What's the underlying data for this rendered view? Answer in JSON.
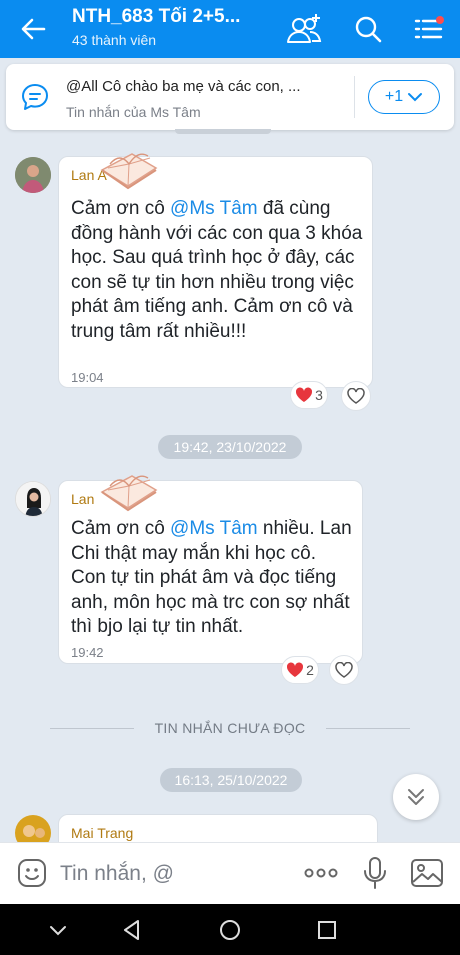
{
  "header": {
    "title": "NTH_683 Tối 2+5...",
    "subtitle": "43 thành viên",
    "icons": [
      "back-arrow-icon",
      "add-member-icon",
      "search-icon",
      "menu-list-icon"
    ],
    "accent": "#0a8cf0"
  },
  "pinned": {
    "text": "@All Cô chào ba mẹ và các con, ...",
    "sender": "Tin nhắn của Ms Tâm",
    "more_label": "+1"
  },
  "messages": [
    {
      "sender": "Lan A",
      "text_before": "Cảm ơn cô ",
      "mention": "@Ms Tâm",
      "text_after": " đã cùng đồng hành với các con qua 3 khóa học. Sau quá trình học ở đây, các con sẽ tự tin hơn nhiều trong việc phát âm tiếng anh. Cảm ơn cô và trung tâm rất nhiều!!!",
      "time": "19:04",
      "reaction_count": "3"
    },
    {
      "sender": "Lan",
      "text_before": "Cảm ơn cô ",
      "mention": "@Ms Tâm",
      "text_after": "  nhiều. Lan Chi thật may mắn khi học cô. Con tự tin phát âm và đọc tiếng anh, môn học mà trc con sợ nhất thì bjo lại tự tin nhất.",
      "time": "19:42",
      "reaction_count": "2"
    },
    {
      "sender": "Mai Trang"
    }
  ],
  "dates": [
    "19:42, 23/10/2022",
    "16:13, 25/10/2022"
  ],
  "unread_label": "TIN NHẮN CHƯA ĐỌC",
  "input": {
    "placeholder": "Tin nhắn, @"
  }
}
